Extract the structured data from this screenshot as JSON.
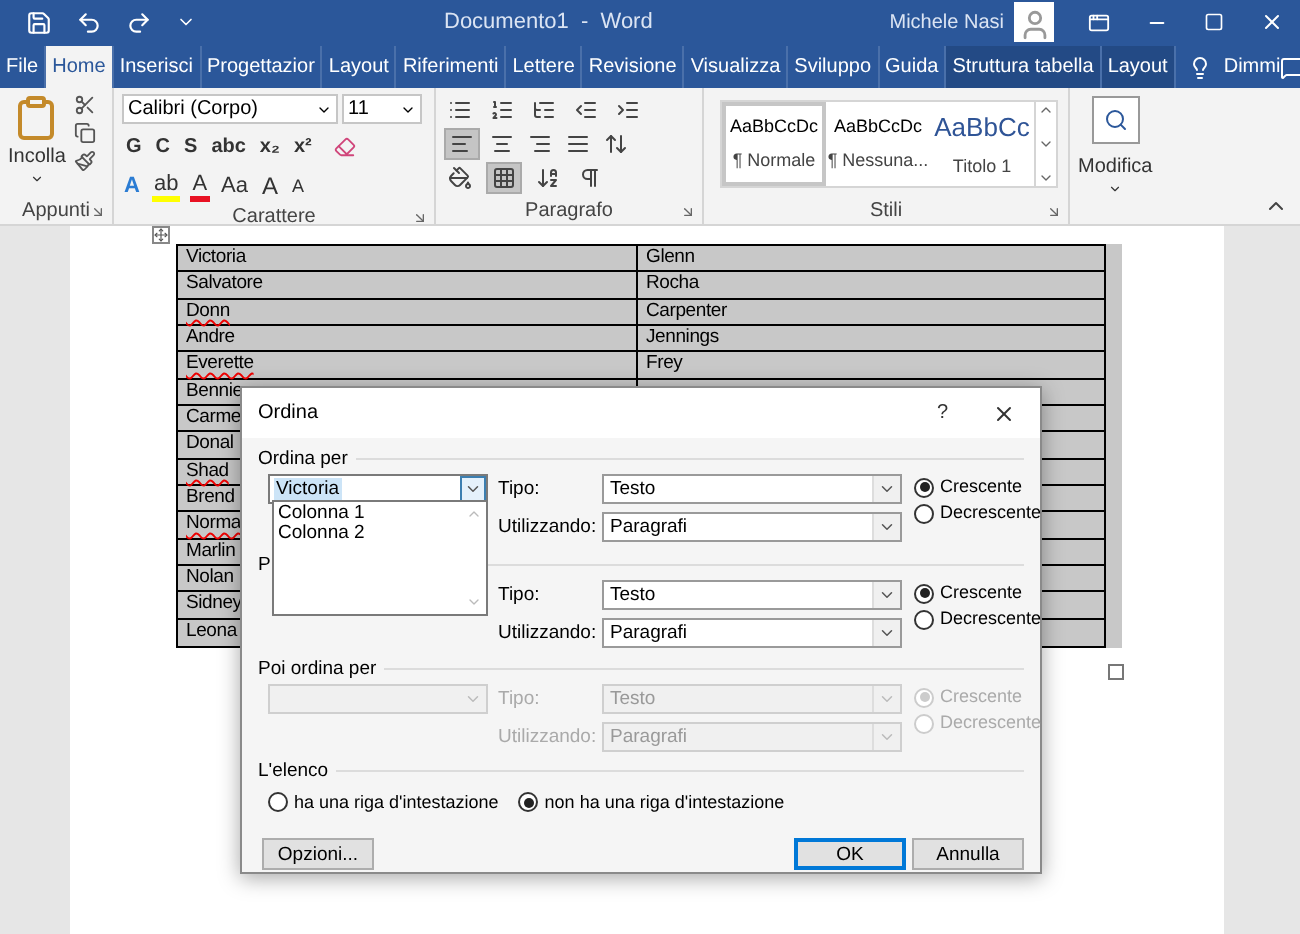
{
  "title_bar": {
    "title": "Documento1  -  Word",
    "user": "Michele Nasi"
  },
  "ribbon_tabs": [
    {
      "label": "File",
      "selected": false,
      "contextual": false
    },
    {
      "label": "Home",
      "selected": true,
      "contextual": false
    },
    {
      "label": "Inserisci",
      "selected": false,
      "contextual": false
    },
    {
      "label": "Progettazior",
      "selected": false,
      "contextual": false
    },
    {
      "label": "Layout",
      "selected": false,
      "contextual": false
    },
    {
      "label": "Riferimenti",
      "selected": false,
      "contextual": false
    },
    {
      "label": "Lettere",
      "selected": false,
      "contextual": false
    },
    {
      "label": "Revisione",
      "selected": false,
      "contextual": false
    },
    {
      "label": "Visualizza",
      "selected": false,
      "contextual": false
    },
    {
      "label": "Sviluppo",
      "selected": false,
      "contextual": false
    },
    {
      "label": "Guida",
      "selected": false,
      "contextual": false
    },
    {
      "label": "Struttura tabella",
      "selected": false,
      "contextual": true
    },
    {
      "label": "Layout",
      "selected": false,
      "contextual": true
    }
  ],
  "tell_me": "Dimmi",
  "ribbon": {
    "clipboard": {
      "paste": "Incolla",
      "label": "Appunti"
    },
    "font": {
      "name": "Calibri (Corpo)",
      "size": "11",
      "row1": [
        "G",
        "C",
        "S",
        "abc",
        "x₂",
        "x²"
      ],
      "row2": [
        {
          "text": "A",
          "kind": "effects"
        },
        {
          "text": "ab",
          "kind": "highlight"
        },
        {
          "text": "A",
          "kind": "fontcolor"
        },
        {
          "text": "Aa",
          "kind": "case"
        },
        {
          "text": "A",
          "kind": "grow"
        },
        {
          "text": "A",
          "kind": "shrink"
        }
      ],
      "label": "Carattere"
    },
    "paragraph": {
      "label": "Paragrafo"
    },
    "styles": {
      "items": [
        {
          "preview": "AaBbCcDc",
          "name": "¶ Normale",
          "selected": true,
          "kind": "body"
        },
        {
          "preview": "AaBbCcDc",
          "name": "¶ Nessuna...",
          "selected": false,
          "kind": "body"
        },
        {
          "preview": "AaBbCc",
          "name": "Titolo 1",
          "selected": false,
          "kind": "heading"
        }
      ],
      "label": "Stili"
    },
    "editing": {
      "label": "Modifica"
    }
  },
  "table": {
    "rows": [
      {
        "cells": [
          {
            "text": "Victoria",
            "misspelled": false
          },
          {
            "text": "Glenn",
            "misspelled": false
          }
        ]
      },
      {
        "cells": [
          {
            "text": "Salvatore",
            "misspelled": false
          },
          {
            "text": "Rocha",
            "misspelled": false
          }
        ]
      },
      {
        "cells": [
          {
            "text": "Donn",
            "misspelled": true
          },
          {
            "text": "Carpenter",
            "misspelled": false
          }
        ]
      },
      {
        "cells": [
          {
            "text": "Andre",
            "misspelled": false
          },
          {
            "text": "Jennings",
            "misspelled": false
          }
        ]
      },
      {
        "cells": [
          {
            "text": "Everette",
            "misspelled": true
          },
          {
            "text": "Frey",
            "misspelled": false
          }
        ]
      },
      {
        "cells": [
          {
            "text": "Bennie",
            "misspelled": false
          }
        ]
      },
      {
        "cells": [
          {
            "text": "Carme",
            "misspelled": false
          }
        ]
      },
      {
        "cells": [
          {
            "text": "Donal",
            "misspelled": false
          }
        ]
      },
      {
        "cells": [
          {
            "text": "Shad",
            "misspelled": true
          }
        ]
      },
      {
        "cells": [
          {
            "text": "Brend",
            "misspelled": false
          }
        ]
      },
      {
        "cells": [
          {
            "text": "Norma",
            "misspelled": true
          }
        ]
      },
      {
        "cells": [
          {
            "text": "Marlin",
            "misspelled": false
          }
        ]
      },
      {
        "cells": [
          {
            "text": "Nolan",
            "misspelled": false
          }
        ]
      },
      {
        "cells": [
          {
            "text": "Sidney",
            "misspelled": false
          }
        ]
      },
      {
        "cells": [
          {
            "text": "Leona",
            "misspelled": false
          }
        ]
      }
    ]
  },
  "dialog": {
    "title": "Ordina",
    "help": "?",
    "sections": [
      {
        "label": "Ordina per",
        "disabled": false,
        "field": {
          "value": "Victoria",
          "highlighted": true,
          "open": true,
          "options": [
            "Colonna 1",
            "Colonna 2"
          ]
        },
        "type_label": "Tipo:",
        "type": "Testo",
        "using_label": "Utilizzando:",
        "using": "Paragrafi",
        "order": [
          {
            "label": "Crescente",
            "selected": true
          },
          {
            "label": "Decrescente",
            "selected": false
          }
        ]
      },
      {
        "label": "P",
        "disabled": false,
        "type_label": "Tipo:",
        "type": "Testo",
        "using_label": "Utilizzando:",
        "using": "Paragrafi",
        "order": [
          {
            "label": "Crescente",
            "selected": true
          },
          {
            "label": "Decrescente",
            "selected": false
          }
        ]
      },
      {
        "label": "Poi ordina per",
        "disabled": true,
        "field": {
          "open": false
        },
        "type_label": "Tipo:",
        "type": "Testo",
        "using_label": "Utilizzando:",
        "using": "Paragrafi",
        "order": [
          {
            "label": "Crescente",
            "selected": true
          },
          {
            "label": "Decrescente",
            "selected": false
          }
        ]
      }
    ],
    "list_label": "L'elenco",
    "header_options": [
      {
        "label": "ha una riga d'intestazione",
        "selected": false
      },
      {
        "label": "non ha una riga d'intestazione",
        "selected": true
      }
    ],
    "buttons": [
      {
        "label": "Opzioni...",
        "default": false
      },
      {
        "label": "OK",
        "default": true
      },
      {
        "label": "Annulla",
        "default": false
      }
    ]
  }
}
